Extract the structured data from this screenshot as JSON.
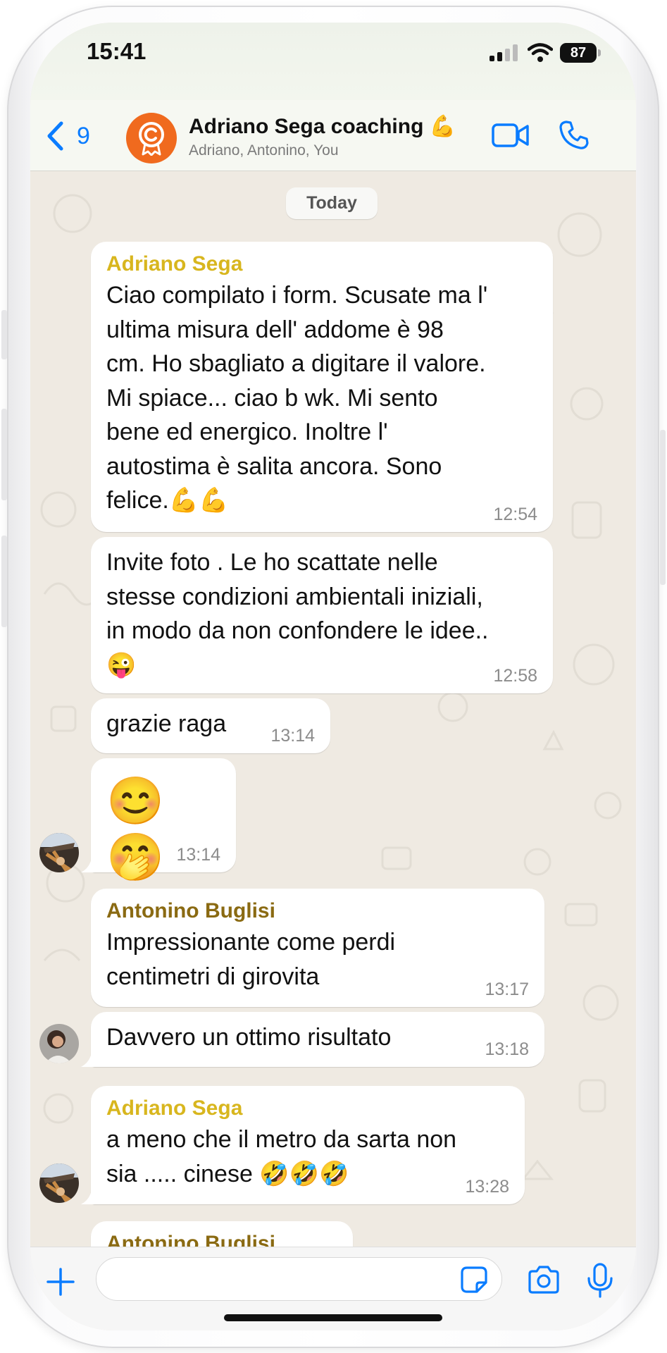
{
  "status_bar": {
    "time": "15:41",
    "battery": "87"
  },
  "header": {
    "back_count": "9",
    "title": "Adriano Sega coaching 💪",
    "subtitle": "Adriano, Antonino, You"
  },
  "chat": {
    "date_chip": "Today",
    "messages": [
      {
        "sender": "Adriano Sega",
        "text": "Ciao compilato i form. Scusate ma l'\nultima misura dell' addome è 98\ncm. Ho sbagliato a digitare il valore.\nMi spiace... ciao b wk. Mi sento\nbene ed energico. Inoltre l'\nautostima è salita ancora. Sono\nfelice.💪💪",
        "time": "12:54"
      },
      {
        "sender": "",
        "text": "Invite foto . Le ho scattate nelle\nstesse condizioni ambientali iniziali,\nin modo da non confondere le idee..\n😜",
        "time": "12:58"
      },
      {
        "sender": "",
        "text": "grazie raga",
        "time": "13:14"
      },
      {
        "sender": "",
        "text": "😊 🤭",
        "time": "13:14"
      },
      {
        "sender": "Antonino Buglisi",
        "text": "Impressionante come perdi\ncentimetri di girovita",
        "time": "13:17"
      },
      {
        "sender": "",
        "text": "Davvero un ottimo risultato",
        "time": "13:18"
      },
      {
        "sender": "Adriano Sega",
        "text": "a meno che il metro da sarta non\nsia ..... cinese 🤣🤣🤣",
        "time": "13:28"
      },
      {
        "sender": "Antonino Buglisi",
        "text": "",
        "time": ""
      }
    ]
  },
  "input": {
    "placeholder": ""
  },
  "colors": {
    "accent": "#0a7cff",
    "sender_adriano": "#d8b61e",
    "sender_antonino": "#8a6a12",
    "chat_background": "#efeae2",
    "avatar_group": "#f06a1e"
  },
  "icons": [
    "chevron-left-icon",
    "group-avatar-icon",
    "video-call-icon",
    "phone-icon",
    "plus-icon",
    "sticker-icon",
    "camera-icon",
    "microphone-icon",
    "signal-icon",
    "wifi-icon",
    "battery-icon"
  ]
}
